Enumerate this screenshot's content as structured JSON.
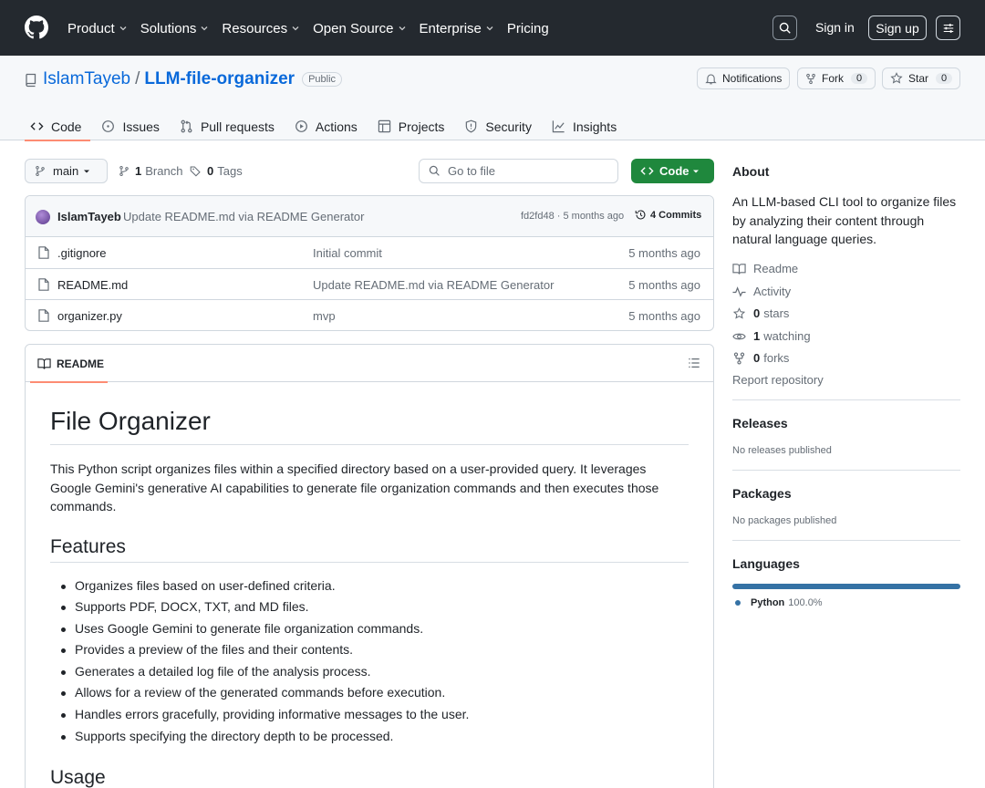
{
  "header": {
    "nav": [
      {
        "label": "Product",
        "dropdown": true
      },
      {
        "label": "Solutions",
        "dropdown": true
      },
      {
        "label": "Resources",
        "dropdown": true
      },
      {
        "label": "Open Source",
        "dropdown": true
      },
      {
        "label": "Enterprise",
        "dropdown": true
      },
      {
        "label": "Pricing",
        "dropdown": false
      }
    ],
    "sign_in": "Sign in",
    "sign_up": "Sign up"
  },
  "repo": {
    "owner": "IslamTayeb",
    "separator": "/",
    "name": "LLM-file-organizer",
    "visibility": "Public",
    "notifications_label": "Notifications",
    "fork_label": "Fork",
    "fork_count": "0",
    "star_label": "Star",
    "star_count": "0",
    "tabs": [
      {
        "label": "Code",
        "icon": "code-icon"
      },
      {
        "label": "Issues",
        "icon": "issue-icon"
      },
      {
        "label": "Pull requests",
        "icon": "pull-request-icon"
      },
      {
        "label": "Actions",
        "icon": "play-icon"
      },
      {
        "label": "Projects",
        "icon": "table-icon"
      },
      {
        "label": "Security",
        "icon": "shield-icon"
      },
      {
        "label": "Insights",
        "icon": "graph-icon"
      }
    ]
  },
  "toolbar": {
    "branch": "main",
    "branch_count": "1",
    "branch_label": "Branch",
    "tag_count": "0",
    "tag_label": "Tags",
    "go_to_file": "Go to file",
    "code_button": "Code"
  },
  "latest_commit": {
    "author": "IslamTayeb",
    "message": "Update README.md via README Generator",
    "hash_time": "fd2fd48 · 5 months ago",
    "commits": "4 Commits"
  },
  "files": [
    {
      "name": ".gitignore",
      "message": "Initial commit",
      "age": "5 months ago"
    },
    {
      "name": "README.md",
      "message": "Update README.md via README Generator",
      "age": "5 months ago"
    },
    {
      "name": "organizer.py",
      "message": "mvp",
      "age": "5 months ago"
    }
  ],
  "readme": {
    "tab_label": "README",
    "title": "File Organizer",
    "intro": "This Python script organizes files within a specified directory based on a user-provided query. It leverages Google Gemini's generative AI capabilities to generate file organization commands and then executes those commands.",
    "features_heading": "Features",
    "features": [
      "Organizes files based on user-defined criteria.",
      "Supports PDF, DOCX, TXT, and MD files.",
      "Uses Google Gemini to generate file organization commands.",
      "Provides a preview of the files and their contents.",
      "Generates a detailed log file of the analysis process.",
      "Allows for a review of the generated commands before execution.",
      "Handles errors gracefully, providing informative messages to the user.",
      "Supports specifying the directory depth to be processed."
    ],
    "usage_heading": "Usage"
  },
  "sidebar": {
    "about_title": "About",
    "description": "An LLM-based CLI tool to organize files by analyzing their content through natural language queries.",
    "readme_link": "Readme",
    "activity_link": "Activity",
    "stars_count": "0",
    "stars_label": "stars",
    "watching_count": "1",
    "watching_label": "watching",
    "forks_count": "0",
    "forks_label": "forks",
    "report": "Report repository",
    "releases_title": "Releases",
    "releases_text": "No releases published",
    "packages_title": "Packages",
    "packages_text": "No packages published",
    "languages_title": "Languages",
    "languages": [
      {
        "name": "Python",
        "percent": "100.0%",
        "color": "#3572A5"
      }
    ]
  },
  "colors": {
    "header_bg": "#24292f",
    "accent_link": "#0969da",
    "code_green": "#1f883d",
    "tab_underline": "#fd8c73"
  }
}
